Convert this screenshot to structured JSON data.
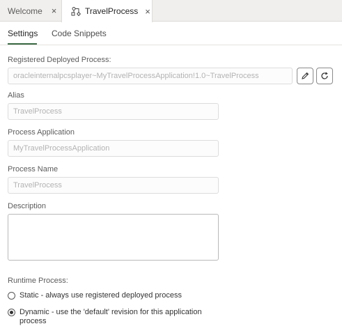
{
  "tabs": [
    {
      "label": "Welcome",
      "close": "×"
    },
    {
      "label": "TravelProcess",
      "close": "×",
      "icon": "process-icon"
    }
  ],
  "subtabs": [
    "Settings",
    "Code Snippets"
  ],
  "form": {
    "registered_label": "Registered Deployed Process:",
    "registered_value": "oracleinternalpcsplayer~MyTravelProcessApplication!1.0~TravelProcess",
    "alias_label": "Alias",
    "alias_value": "TravelProcess",
    "app_label": "Process Application",
    "app_value": "MyTravelProcessApplication",
    "name_label": "Process Name",
    "name_value": "TravelProcess",
    "description_label": "Description",
    "description_value": "",
    "runtime_label": "Runtime Process:",
    "options": [
      {
        "label": "Static - always use registered deployed process",
        "checked": false
      },
      {
        "label": "Dynamic - use the 'default' revision for this application process",
        "checked": true
      }
    ]
  },
  "icons": {
    "edit": "pencil-icon",
    "refresh": "refresh-icon"
  }
}
